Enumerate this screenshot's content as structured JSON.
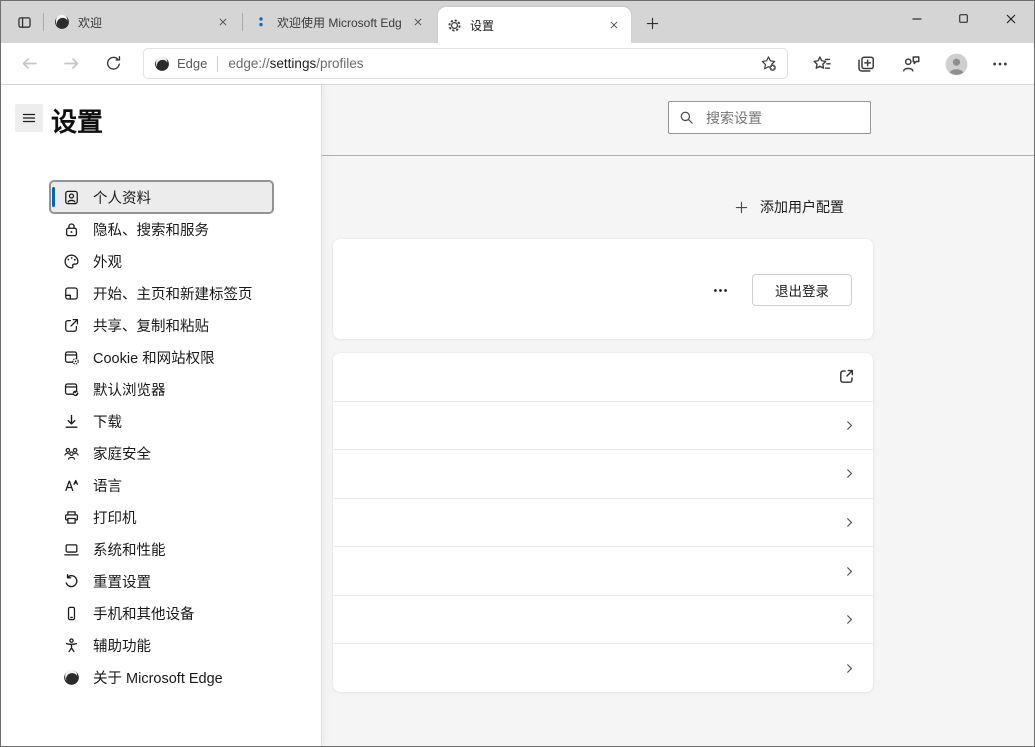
{
  "tabs": [
    {
      "title": "欢迎",
      "favicon": "edge-logo-icon",
      "active": false
    },
    {
      "title": "欢迎使用 Microsoft Edg",
      "favicon": "blue-dots-icon",
      "active": false
    },
    {
      "title": "设置",
      "favicon": "gear-icon",
      "active": true
    }
  ],
  "toolbar": {
    "site_label": "Edge",
    "url": {
      "scheme": "edge://",
      "host": "settings",
      "path": "/profiles"
    }
  },
  "sidebar": {
    "title": "设置",
    "items": [
      {
        "label": "个人资料",
        "icon": "profile-card-icon",
        "selected": true
      },
      {
        "label": "隐私、搜索和服务",
        "icon": "lock-icon",
        "selected": false
      },
      {
        "label": "外观",
        "icon": "palette-icon",
        "selected": false
      },
      {
        "label": "开始、主页和新建标签页",
        "icon": "start-page-icon",
        "selected": false
      },
      {
        "label": "共享、复制和粘贴",
        "icon": "share-icon",
        "selected": false
      },
      {
        "label": "Cookie 和网站权限",
        "icon": "cookie-permissions-icon",
        "selected": false
      },
      {
        "label": "默认浏览器",
        "icon": "default-browser-icon",
        "selected": false
      },
      {
        "label": "下载",
        "icon": "download-icon",
        "selected": false
      },
      {
        "label": "家庭安全",
        "icon": "family-icon",
        "selected": false
      },
      {
        "label": "语言",
        "icon": "language-icon",
        "selected": false
      },
      {
        "label": "打印机",
        "icon": "printer-icon",
        "selected": false
      },
      {
        "label": "系统和性能",
        "icon": "system-icon",
        "selected": false
      },
      {
        "label": "重置设置",
        "icon": "reset-icon",
        "selected": false
      },
      {
        "label": "手机和其他设备",
        "icon": "phone-icon",
        "selected": false
      },
      {
        "label": "辅助功能",
        "icon": "accessibility-icon",
        "selected": false
      },
      {
        "label": "关于 Microsoft Edge",
        "icon": "edge-logo-icon",
        "selected": false
      }
    ]
  },
  "main": {
    "search": {
      "placeholder": "搜索设置",
      "icon": "search-icon"
    },
    "add_profile": {
      "label": "添加用户配置",
      "icon": "plus-icon"
    },
    "profile_card": {
      "more_icon": "more-horizontal-icon",
      "sign_out_label": "退出登录"
    },
    "settings_rows": [
      {
        "trailing_icon": "external-link-icon"
      },
      {
        "trailing_icon": "chevron-right-icon"
      },
      {
        "trailing_icon": "chevron-right-icon"
      },
      {
        "trailing_icon": "chevron-right-icon"
      },
      {
        "trailing_icon": "chevron-right-icon"
      },
      {
        "trailing_icon": "chevron-right-icon"
      },
      {
        "trailing_icon": "chevron-right-icon"
      }
    ]
  },
  "colors": {
    "accent_blue": "#0067c0",
    "favicon_blue": "#0b6fc2",
    "titlebar_bg": "#d5d5d5",
    "page_bg": "#f5f5f5"
  }
}
